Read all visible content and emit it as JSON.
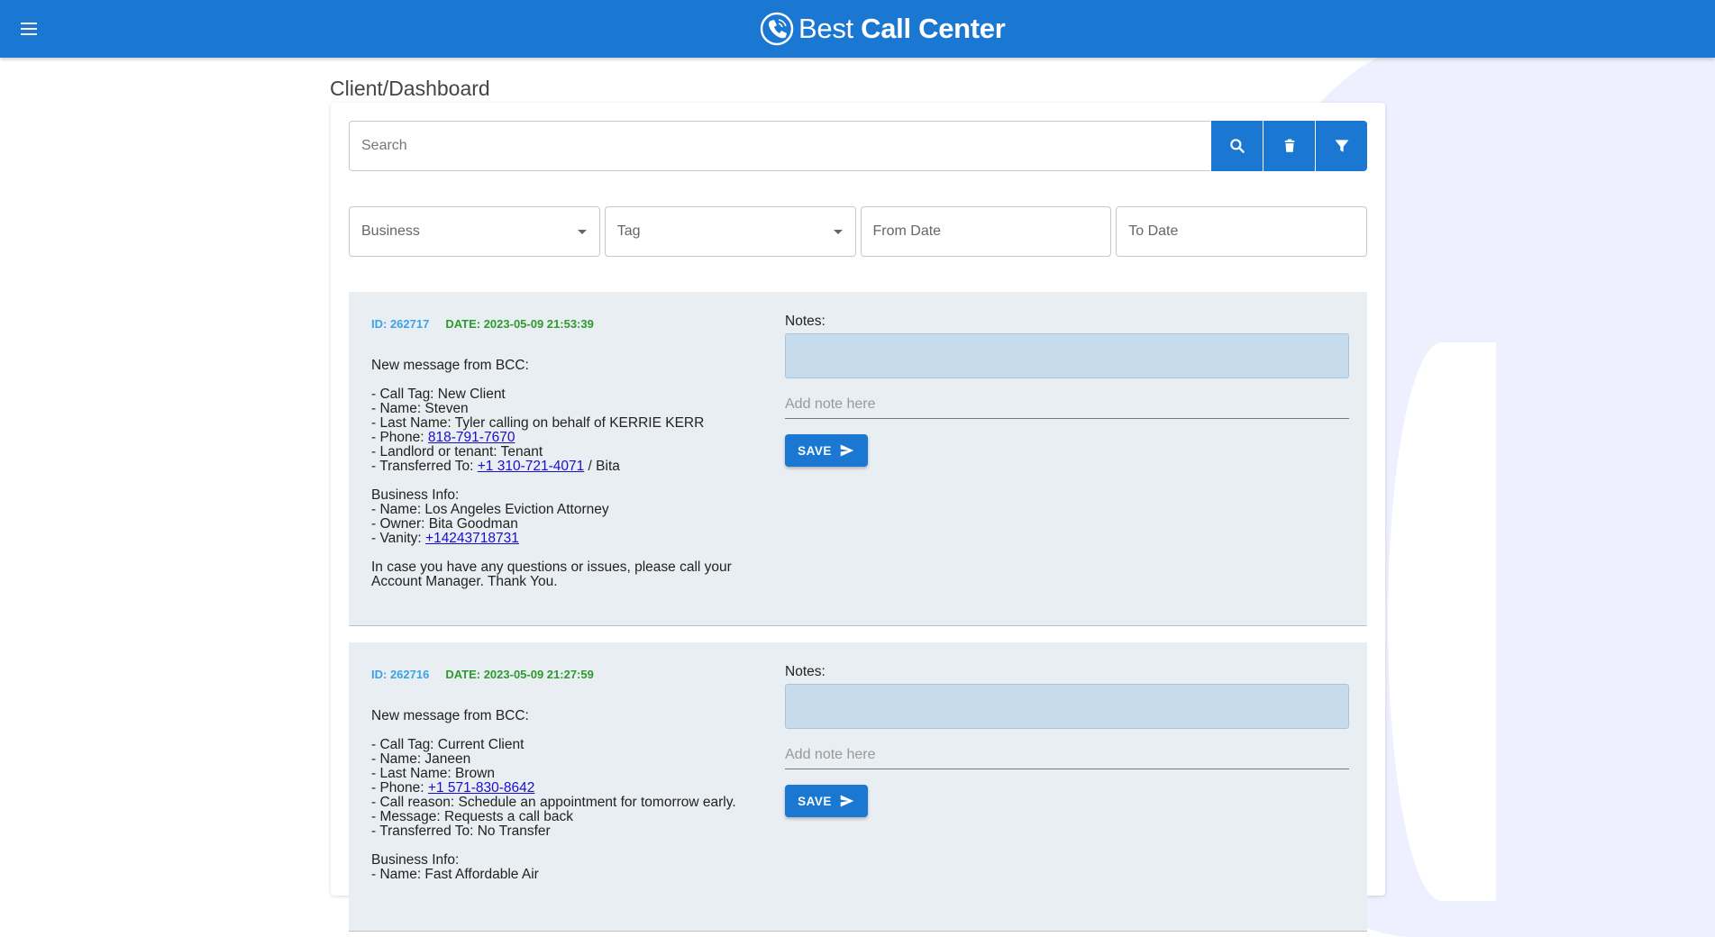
{
  "header": {
    "brand_light": "Best ",
    "brand_bold": "Call Center"
  },
  "page_title": "Client/Dashboard",
  "search": {
    "placeholder": "Search"
  },
  "filters": {
    "business": "Business",
    "tag": "Tag",
    "from_date": "From Date",
    "to_date": "To Date"
  },
  "colors": {
    "primary": "#1a77d2",
    "card_bg": "#e9eef2",
    "notes_bg": "#c6dbeb",
    "id_color": "#3aa3e8",
    "date_color": "#2e9a2e"
  },
  "messages": [
    {
      "id": "ID: 262717",
      "date": "DATE: 2023-05-09 21:53:39",
      "intro": "New message from BCC:",
      "l1": "- Call Tag: New Client",
      "l2": "- Name: Steven",
      "l3": "- Last Name: Tyler calling on behalf of KERRIE KERR",
      "l4_prefix": "- Phone: ",
      "l4_link": "818-791-7670",
      "l5": "- Landlord or tenant: Tenant",
      "l6_prefix": "- Transferred To: ",
      "l6_link": "+1 310-721-4071",
      "l6_suffix": " / Bita",
      "biz_title": "Business Info:",
      "b1": "- Name: Los Angeles Eviction Attorney",
      "b2": "- Owner: Bita Goodman",
      "b3_prefix": "- Vanity: ",
      "b3_link": "+14243718731",
      "closing1": "In case you have any questions or issues, please call your",
      "closing2": "Account Manager. Thank You.",
      "notes_label": "Notes:",
      "note_placeholder": "Add note here",
      "save_label": "SAVE"
    },
    {
      "id": "ID: 262716",
      "date": "DATE: 2023-05-09 21:27:59",
      "intro": "New message from BCC:",
      "l1": "- Call Tag: Current Client",
      "l2": "- Name: Janeen",
      "l3": "- Last Name: Brown",
      "l4_prefix": "- Phone: ",
      "l4_link": "+1 571-830-8642",
      "l5": "- Call reason: Schedule an appointment for tomorrow early.",
      "l6": "- Message: Requests a call back",
      "l7": "- Transferred To: No Transfer",
      "biz_title": "Business Info:",
      "b1": "- Name: Fast Affordable Air",
      "notes_label": "Notes:",
      "note_placeholder": "Add note here",
      "save_label": "SAVE"
    }
  ]
}
